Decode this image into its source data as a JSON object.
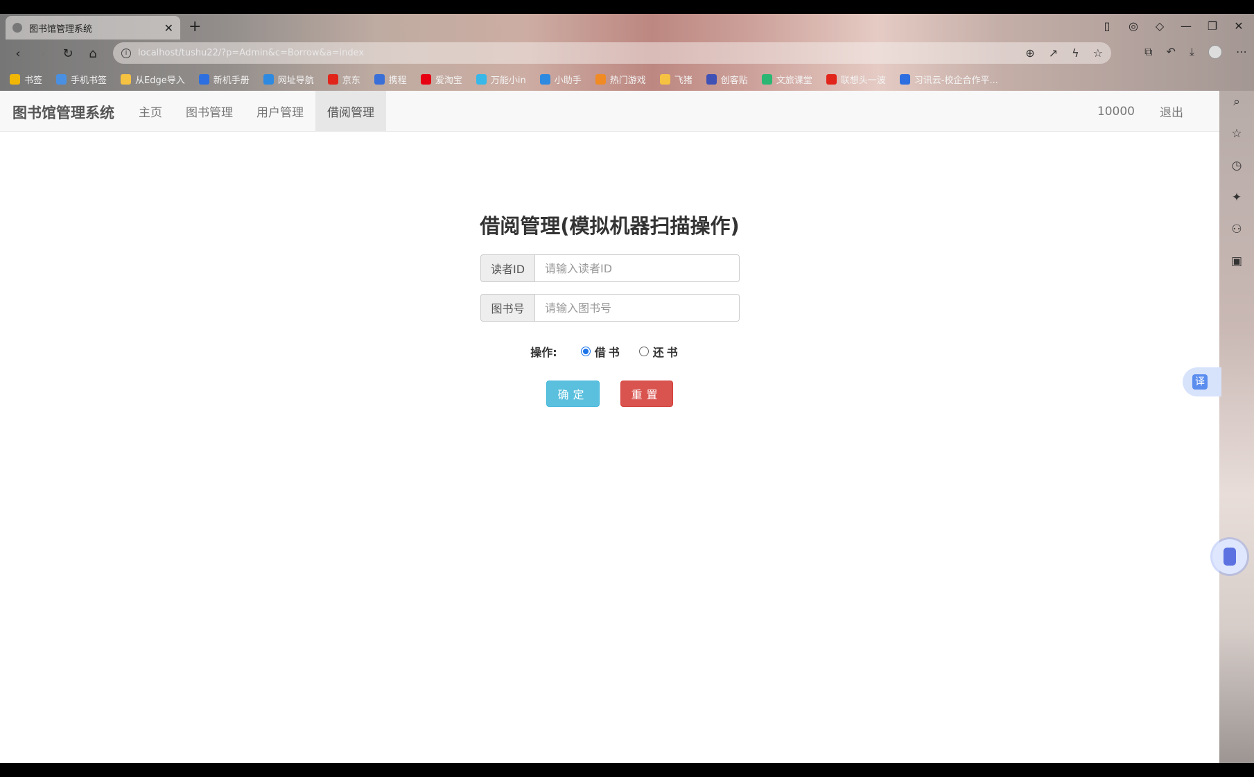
{
  "browser": {
    "tab_title": "图书馆管理系统",
    "tab_close": "✕",
    "new_tab": "+",
    "url": "localhost/tushu22/?p=Admin&c=Borrow&a=index",
    "bookmarks": [
      {
        "label": "书签",
        "color": "#f2b705"
      },
      {
        "label": "手机书签",
        "color": "#4a90e2"
      },
      {
        "label": "从Edge导入",
        "color": "#f5c242"
      },
      {
        "label": "新机手册",
        "color": "#2d6fe0"
      },
      {
        "label": "网址导航",
        "color": "#2d8ae0"
      },
      {
        "label": "京东",
        "color": "#e1251b"
      },
      {
        "label": "携程",
        "color": "#3a6fd8"
      },
      {
        "label": "爱淘宝",
        "color": "#e60012"
      },
      {
        "label": "万能小in",
        "color": "#38b8e8"
      },
      {
        "label": "小助手",
        "color": "#2d8ae0"
      },
      {
        "label": "热门游戏",
        "color": "#f08a24"
      },
      {
        "label": "飞猪",
        "color": "#f5c242"
      },
      {
        "label": "创客贴",
        "color": "#3f51b5"
      },
      {
        "label": "文旅课堂",
        "color": "#2bb673"
      },
      {
        "label": "联想头一波",
        "color": "#e1251b"
      },
      {
        "label": "习讯云-校企合作平...",
        "color": "#2d6fe0"
      }
    ]
  },
  "navbar": {
    "brand": "图书馆管理系统",
    "links": [
      "主页",
      "图书管理",
      "用户管理",
      "借阅管理"
    ],
    "active": "借阅管理",
    "user": "10000",
    "logout": "退出"
  },
  "form": {
    "title": "借阅管理(模拟机器扫描操作)",
    "reader_label": "读者ID",
    "reader_placeholder": "请输入读者ID",
    "book_label": "图书号",
    "book_placeholder": "请输入图书号",
    "operation_label": "操作:",
    "options": [
      "借书",
      "还书"
    ],
    "selected_option": "借书",
    "submit": "确定",
    "reset": "重置"
  },
  "colors": {
    "submit_bg": "#5bc0de",
    "reset_bg": "#d9534f",
    "radio_checked": "#1a73e8"
  },
  "floating": {
    "translate": "译"
  }
}
